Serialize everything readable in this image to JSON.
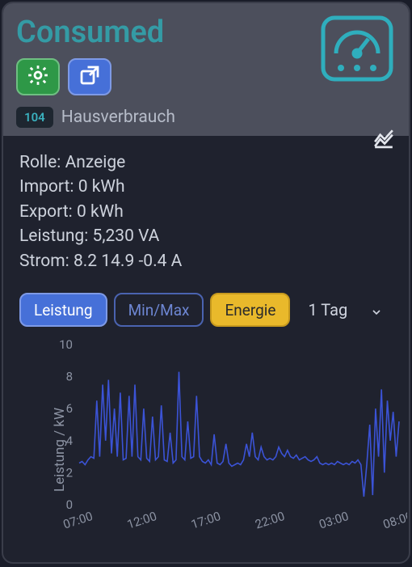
{
  "header": {
    "title": "Consumed",
    "id_badge": "104",
    "subtitle": "Hausverbrauch"
  },
  "info": {
    "rolle_label": "Rolle:",
    "rolle_value": "Anzeige",
    "import_label": "Import:",
    "import_value": "0 kWh",
    "export_label": "Export:",
    "export_value": "0 kWh",
    "leistung_label": "Leistung:",
    "leistung_value": "5,230 VA",
    "strom_label": "Strom:",
    "strom_value": "8.2 14.9 -0.4 A"
  },
  "controls": {
    "btn_leistung": "Leistung",
    "btn_minmax": "Min/Max",
    "btn_energie": "Energie",
    "range_label": "1 Tag"
  },
  "chart_data": {
    "type": "line",
    "title": "",
    "xlabel": "",
    "ylabel": "Leistung / kW",
    "ylim": [
      0,
      10
    ],
    "yticks": [
      0,
      2,
      4,
      6,
      8,
      10
    ],
    "xticks": [
      "07:00",
      "12:00",
      "17:00",
      "22:00",
      "03:00",
      "08:00"
    ],
    "x": [
      "07:00",
      "07:15",
      "07:30",
      "07:45",
      "08:00",
      "08:15",
      "08:30",
      "08:45",
      "09:00",
      "09:15",
      "09:30",
      "09:45",
      "10:00",
      "10:15",
      "10:30",
      "10:45",
      "11:00",
      "11:15",
      "11:30",
      "11:45",
      "12:00",
      "12:15",
      "12:30",
      "12:45",
      "13:00",
      "13:15",
      "13:30",
      "13:45",
      "14:00",
      "14:15",
      "14:30",
      "14:45",
      "15:00",
      "15:15",
      "15:30",
      "15:45",
      "16:00",
      "16:15",
      "16:30",
      "16:45",
      "17:00",
      "17:15",
      "17:30",
      "17:45",
      "18:00",
      "18:15",
      "18:30",
      "18:45",
      "19:00",
      "19:15",
      "19:30",
      "19:45",
      "20:00",
      "20:15",
      "20:30",
      "20:45",
      "21:00",
      "21:15",
      "21:30",
      "21:45",
      "22:00",
      "22:15",
      "22:30",
      "22:45",
      "23:00",
      "23:15",
      "23:30",
      "23:45",
      "00:00",
      "00:15",
      "00:30",
      "00:45",
      "01:00",
      "01:15",
      "01:30",
      "01:45",
      "02:00",
      "02:15",
      "02:30",
      "02:45",
      "03:00",
      "03:15",
      "03:30",
      "03:45",
      "04:00",
      "04:15",
      "04:30",
      "04:45",
      "05:00",
      "05:15",
      "05:30",
      "05:45",
      "06:00",
      "06:15",
      "06:30",
      "06:45",
      "07:00n",
      "07:15n",
      "07:30n",
      "07:45n",
      "08:00n",
      "08:15n",
      "08:30n",
      "08:45n",
      "09:00n",
      "09:15n",
      "09:30n",
      "09:45n",
      "10:00n",
      "10:15n"
    ],
    "values": [
      2.6,
      2.7,
      2.5,
      2.8,
      3.0,
      2.9,
      6.5,
      3.0,
      7.5,
      4.0,
      7.8,
      3.2,
      6.0,
      3.0,
      7.0,
      2.8,
      2.9,
      6.8,
      3.0,
      7.5,
      3.0,
      2.8,
      6.0,
      2.9,
      2.7,
      5.5,
      2.8,
      3.0,
      6.2,
      2.8,
      2.7,
      4.5,
      2.6,
      2.8,
      8.3,
      3.0,
      2.8,
      5.2,
      2.9,
      3.0,
      6.8,
      3.0,
      2.7,
      2.6,
      2.8,
      2.5,
      4.4,
      2.6,
      2.5,
      2.7,
      3.8,
      2.6,
      2.4,
      2.5,
      2.6,
      2.5,
      2.8,
      3.8,
      3.0,
      4.5,
      3.0,
      2.8,
      3.6,
      3.0,
      2.8,
      2.9,
      2.8,
      3.0,
      3.6,
      3.2,
      3.0,
      3.4,
      3.0,
      2.9,
      3.1,
      2.8,
      2.9,
      3.0,
      2.8,
      2.7,
      2.8,
      3.0,
      2.6,
      2.5,
      2.6,
      2.5,
      2.6,
      2.5,
      2.7,
      2.6,
      2.5,
      2.6,
      2.5,
      2.7,
      2.6,
      2.8,
      2.5,
      0.5,
      2.5,
      5.0,
      0.6,
      6.0,
      3.0,
      7.2,
      2.0,
      6.5,
      4.0,
      5.8,
      3.0,
      5.2
    ]
  },
  "colors": {
    "accent": "#349ba5",
    "series": "#3b53d6",
    "btn_blue": "#4670d8",
    "btn_green": "#2e9847",
    "btn_yellow": "#e9b92b"
  }
}
